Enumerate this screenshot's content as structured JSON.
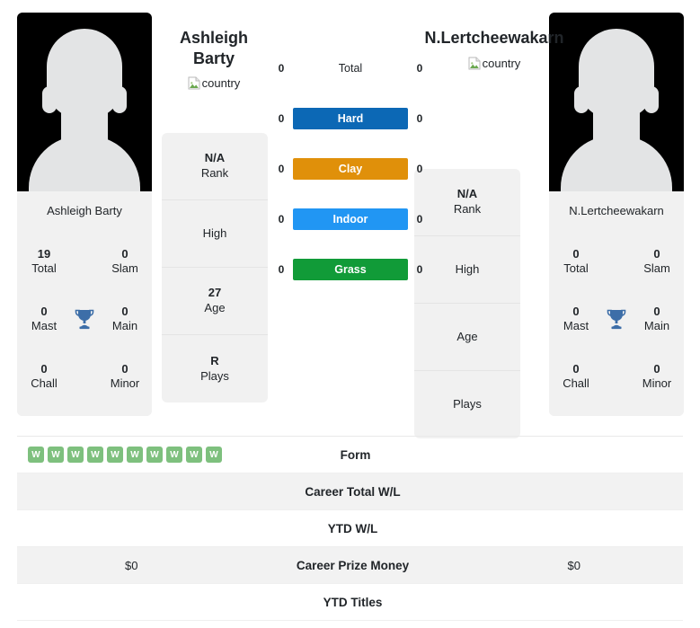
{
  "players": {
    "left": {
      "name": "Ashleigh Barty",
      "name_lines": [
        "Ashleigh",
        "Barty"
      ],
      "country_alt": "country",
      "photo_caption": "Ashleigh Barty",
      "titles": [
        {
          "value": "19",
          "label": "Total"
        },
        {
          "value": "0",
          "label": "Slam"
        },
        {
          "value": "0",
          "label": "Mast"
        },
        {
          "value": "0",
          "label": "Main"
        },
        {
          "value": "0",
          "label": "Chall"
        },
        {
          "value": "0",
          "label": "Minor"
        }
      ],
      "info": [
        {
          "value": "N/A",
          "label": "Rank"
        },
        {
          "value": "",
          "label": "High"
        },
        {
          "value": "27",
          "label": "Age"
        },
        {
          "value": "R",
          "label": "Plays"
        }
      ]
    },
    "right": {
      "name": "N.Lertcheewakarn",
      "name_lines": [
        "N.Lertcheewakarn"
      ],
      "country_alt": "country",
      "photo_caption": "N.Lertcheewakarn",
      "titles": [
        {
          "value": "0",
          "label": "Total"
        },
        {
          "value": "0",
          "label": "Slam"
        },
        {
          "value": "0",
          "label": "Mast"
        },
        {
          "value": "0",
          "label": "Main"
        },
        {
          "value": "0",
          "label": "Chall"
        },
        {
          "value": "0",
          "label": "Minor"
        }
      ],
      "info": [
        {
          "value": "N/A",
          "label": "Rank"
        },
        {
          "value": "",
          "label": "High"
        },
        {
          "value": "",
          "label": "Age"
        },
        {
          "value": "",
          "label": "Plays"
        }
      ]
    }
  },
  "surfaces": [
    {
      "label": "Total",
      "left": "0",
      "right": "0",
      "style": "plain",
      "color": ""
    },
    {
      "label": "Hard",
      "left": "0",
      "right": "0",
      "style": "hard",
      "color": "#0c68b5"
    },
    {
      "label": "Clay",
      "left": "0",
      "right": "0",
      "style": "clay",
      "color": "#e0900a"
    },
    {
      "label": "Indoor",
      "left": "0",
      "right": "0",
      "style": "indoor",
      "color": "#2196f3"
    },
    {
      "label": "Grass",
      "left": "0",
      "right": "0",
      "style": "grass",
      "color": "#119b38"
    }
  ],
  "comparison_rows": [
    {
      "label": "Form",
      "left": "",
      "right": "",
      "left_form": [
        "W",
        "W",
        "W",
        "W",
        "W",
        "W",
        "W",
        "W",
        "W",
        "W"
      ],
      "right_form": []
    },
    {
      "label": "Career Total W/L",
      "left": "",
      "right": "",
      "left_form": [],
      "right_form": []
    },
    {
      "label": "YTD W/L",
      "left": "",
      "right": "",
      "left_form": [],
      "right_form": []
    },
    {
      "label": "Career Prize Money",
      "left": "$0",
      "right": "$0",
      "left_form": [],
      "right_form": []
    },
    {
      "label": "YTD Titles",
      "left": "",
      "right": "",
      "left_form": [],
      "right_form": []
    }
  ],
  "icons": {
    "trophy": "trophy-icon",
    "broken_image": "broken-image-icon"
  },
  "colors": {
    "hard": "#0c68b5",
    "clay": "#e0900a",
    "indoor": "#2196f3",
    "grass": "#119b38",
    "form_win": "#7ec07e",
    "trophy": "#3d6ea8",
    "panel_bg": "#f1f1f1"
  }
}
